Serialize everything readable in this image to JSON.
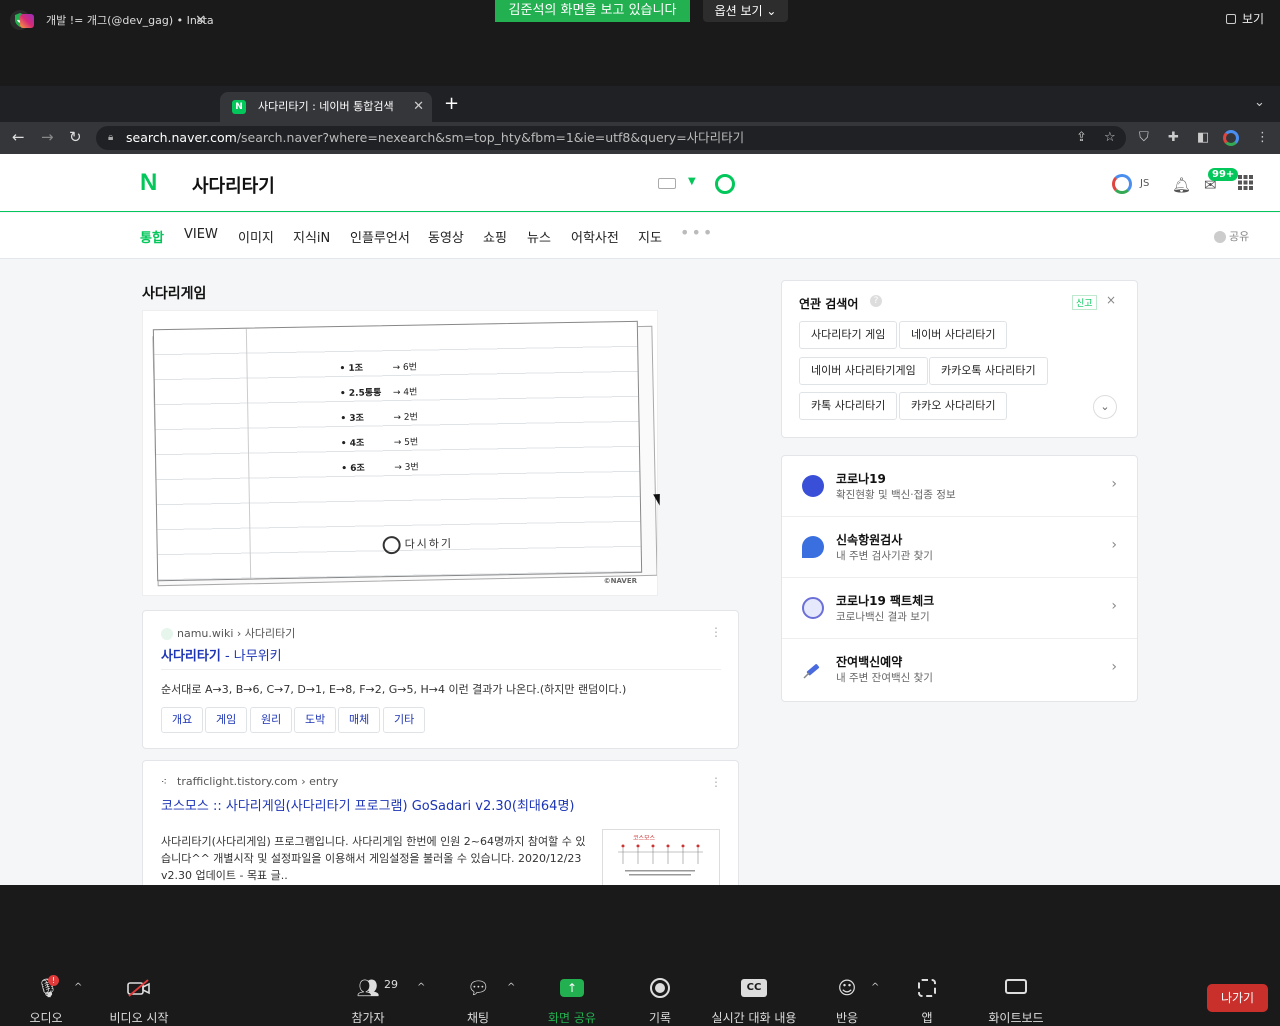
{
  "zoom": {
    "share_banner": "김준석의 화면을 보고 있습니다",
    "options_label": "옵션 보기 ⌄",
    "view_label": "보기",
    "toolbar": [
      {
        "label": "오디오",
        "icon": "microphone-icon"
      },
      {
        "label": "비디오 시작",
        "icon": "video-off-icon"
      },
      {
        "label": "참가자",
        "icon": "participants-icon"
      },
      {
        "label": "채팅",
        "icon": "chat-icon"
      },
      {
        "label": "화면 공유",
        "icon": "share-screen-icon"
      },
      {
        "label": "기록",
        "icon": "record-icon"
      },
      {
        "label": "실시간 대화 내용",
        "icon": "cc-icon"
      },
      {
        "label": "반응",
        "icon": "reaction-icon"
      },
      {
        "label": "앱",
        "icon": "apps-icon"
      },
      {
        "label": "화이트보드",
        "icon": "whiteboard-icon"
      }
    ],
    "participants_count": "29",
    "mic_badge": "!",
    "cc_text": "CC",
    "leave_label": "나가기"
  },
  "browser": {
    "tabs": [
      {
        "title": "개발 != 개그(@dev_gag) • Instagram"
      },
      {
        "title": "사다리타기 : 네이버 통합검색"
      }
    ],
    "new_tab": "+",
    "url_host": "search.naver.com",
    "url_path": "/search.naver?where=nexearch&sm=top_hty&fbm=1&ie=utf8&query=사다리타기"
  },
  "naver": {
    "logo": "N",
    "query": "사다리타기",
    "user_initials": "JS",
    "mail_badge": "99+",
    "tabs": [
      "통합",
      "VIEW",
      "이미지",
      "지식iN",
      "인플루언서",
      "동영상",
      "쇼핑",
      "뉴스",
      "어학사전",
      "지도"
    ],
    "more": "•••",
    "share_label": "공유",
    "section_title": "사다리게임",
    "ladder": {
      "rows": [
        {
          "left": "• 1조",
          "right": "→ 6번"
        },
        {
          "left": "• 2.5통통",
          "right": "→ 4번"
        },
        {
          "left": "• 3조",
          "right": "→ 2번"
        },
        {
          "left": "• 4조",
          "right": "→ 5번"
        },
        {
          "left": "• 6조",
          "right": "→ 3번"
        }
      ],
      "brand": "다시하기",
      "watermark": "©NAVER"
    },
    "result1": {
      "source": "namu.wiki",
      "breadcrumb": "사다리타기",
      "title_bold": "사다리타기",
      "title_rest": " - 나무위키",
      "desc": "순서대로 A→3, B→6, C→7, D→1, E→8, F→2, G→5, H→4 이런 결과가 나온다.(하지만 랜덤이다.)",
      "chips": [
        "개요",
        "게임",
        "원리",
        "도박",
        "매체",
        "기타"
      ]
    },
    "result2": {
      "source": "trafficlight.tistory.com",
      "breadcrumb": "entry",
      "title": "코스모스 :: 사다리게임(사다리타기 프로그램) GoSadari v2.30(최대64명)",
      "desc": "사다리타기(사다리게임) 프로그램입니다. 사다리게임 한번에 인원 2~64명까지 참여할 수 있습니다^^ 개별시작 및 설정파일을 이용해서 게임설정을 불러올 수 있습니다. 2020/12/23 v2.30 업데이트 - 목표 글.."
    },
    "related": {
      "title": "연관 검색어",
      "report": "신고",
      "close": "×",
      "items": [
        "사다리타기 게임",
        "네이버 사다리타기",
        "네이버 사다리타기게임",
        "카카오톡 사다리타기",
        "카톡 사다리타기",
        "카카오 사다리타기"
      ]
    },
    "covid": [
      {
        "title": "코로나19",
        "sub": "확진현황 및 백신·접종 정보",
        "color": "#3a4fd8"
      },
      {
        "title": "신속항원검사",
        "sub": "내 주변 검사기관 찾기",
        "color": "#3a6fe0"
      },
      {
        "title": "코로나19 팩트체크",
        "sub": "코로나백신 결과 보기",
        "color": "#6b6fd8"
      },
      {
        "title": "잔여백신예약",
        "sub": "내 주변 잔여백신 찾기",
        "color": "#4a6be0"
      }
    ]
  }
}
